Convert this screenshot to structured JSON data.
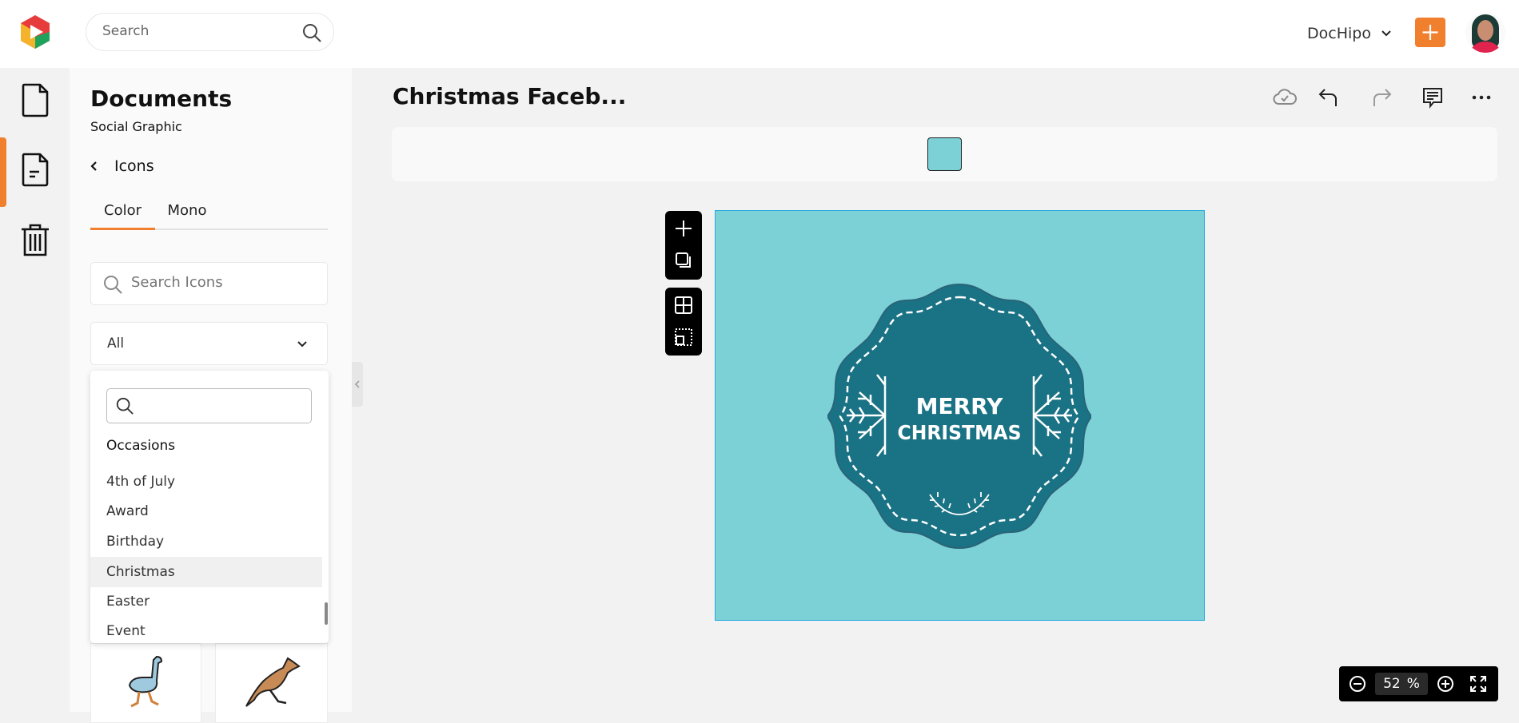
{
  "header": {
    "search_placeholder": "Search",
    "workspace": "DocHipo",
    "add_icon": "plus-icon",
    "avatar": "user-avatar"
  },
  "rail": {
    "items": [
      "document-icon",
      "template-icon",
      "trash-icon"
    ],
    "active": 1
  },
  "panel": {
    "title": "Documents",
    "subtitle": "Social Graphic",
    "back_label": "Icons",
    "tabs": [
      {
        "label": "Color",
        "active": true
      },
      {
        "label": "Mono",
        "active": false
      }
    ],
    "search_placeholder": "Search Icons",
    "category_select": "All",
    "dropdown": {
      "search_value": "",
      "group": "Occasions",
      "items": [
        "4th of July",
        "Award",
        "Birthday",
        "Christmas",
        "Easter",
        "Event"
      ],
      "highlighted": "Christmas"
    },
    "thumbnails": [
      "ostrich-icon",
      "kangaroo-icon"
    ]
  },
  "editor": {
    "doc_title": "Christmas Faceb...",
    "toolbar_icons": [
      "cloud-saved-icon",
      "undo-icon",
      "redo-icon",
      "comment-icon",
      "more-icon"
    ],
    "selected_color": "#7bd1d6",
    "canvas": {
      "background": "#7bd1d6",
      "badge_color": "#1a7285",
      "line1": "MERRY",
      "line2": "CHRISTMAS"
    },
    "zoom": {
      "value": "52",
      "unit": "%"
    }
  },
  "colors": {
    "accent": "#f07f2e"
  }
}
